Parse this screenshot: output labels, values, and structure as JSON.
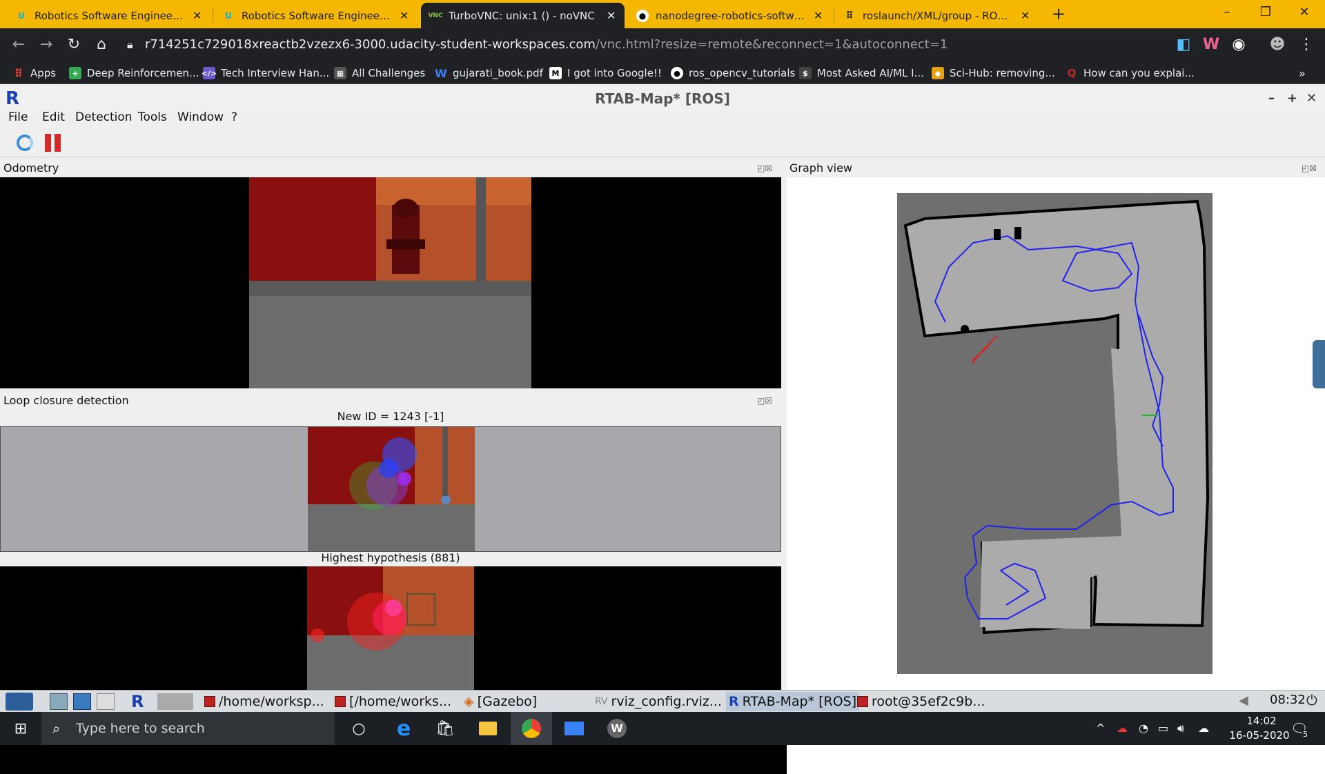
{
  "browser": {
    "tabs": [
      {
        "title": "Robotics Software Engineer - Udacity",
        "icon": "udacity-icon",
        "active": false
      },
      {
        "title": "Robotics Software Engineer - Udacity",
        "icon": "udacity-icon",
        "active": false
      },
      {
        "title": "TurboVNC: unix:1 () - noVNC",
        "icon": "vnc-icon",
        "active": true
      },
      {
        "title": "nanodegree-robotics-software-engineer",
        "icon": "github-icon",
        "active": false
      },
      {
        "title": "roslaunch/XML/group - ROS Wiki",
        "icon": "ros-icon",
        "active": false
      }
    ],
    "url_main": "r714251c729018xreactb2vzezx6-3000.udacity-student-workspaces.com",
    "url_rest": "/vnc.html?resize=remote&reconnect=1&autoconnect=1",
    "bookmarks": [
      {
        "label": "Apps",
        "icon": "apps-icon",
        "color": "#ea4335"
      },
      {
        "label": "Deep Reinforcemen...",
        "icon": "plus-icon",
        "color": "#34a853"
      },
      {
        "label": "Tech Interview Han...",
        "icon": "code-icon",
        "color": "#6a5acd"
      },
      {
        "label": "All Challenges",
        "icon": "challenges-icon",
        "color": "#555555"
      },
      {
        "label": "gujarati_book.pdf",
        "icon": "w-icon",
        "color": "#3b82f6"
      },
      {
        "label": "I got into Google!!",
        "icon": "medium-icon",
        "color": "#000000"
      },
      {
        "label": "ros_opencv_tutorials",
        "icon": "github-icon",
        "color": "#333333"
      },
      {
        "label": "Most Asked AI/ML I...",
        "icon": "dollar-icon",
        "color": "#444444"
      },
      {
        "label": "Sci-Hub: removing...",
        "icon": "scihub-icon",
        "color": "#e8a013"
      },
      {
        "label": "How can you explai...",
        "icon": "quora-icon",
        "color": "#b92b27"
      }
    ]
  },
  "rtab": {
    "title": "RTAB-Map* [ROS]",
    "menu": [
      "File",
      "Edit",
      "Detection",
      "Tools",
      "Window",
      "?"
    ],
    "odometry_title": "Odometry",
    "loop_title": "Loop closure detection",
    "new_id": "New ID = 1243 [-1]",
    "hypothesis": "Highest hypothesis (881)",
    "graph_title": "Graph view"
  },
  "vnc_taskbar": {
    "items": [
      "/home/worksp...",
      "[/home/works...",
      "[Gazebo]",
      "rviz_config.rviz...",
      "RTAB-Map* [ROS]",
      "root@35ef2c9b..."
    ],
    "clock": "08:32"
  },
  "windows": {
    "search_placeholder": "Type here to search",
    "time": "14:02",
    "date": "16-05-2020",
    "notifications": "5"
  },
  "colors": {
    "chrome_tab_bar": "#f5b700",
    "chrome_dark": "#202124",
    "map_bg": "#6f6f6f",
    "map_floor": "#ababab",
    "path": "#2222ee"
  }
}
